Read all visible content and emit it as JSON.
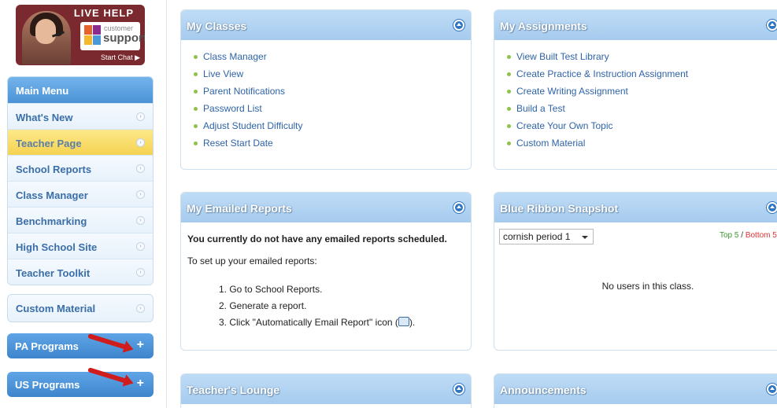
{
  "live_help": {
    "title": "LIVE HELP",
    "logo_small": "customer",
    "logo_big": "support",
    "start_chat": "Start Chat ▶"
  },
  "menu": {
    "header": "Main Menu",
    "items": [
      {
        "label": "What's New"
      },
      {
        "label": "Teacher Page"
      },
      {
        "label": "School Reports"
      },
      {
        "label": "Class Manager"
      },
      {
        "label": "Benchmarking"
      },
      {
        "label": "High School Site"
      },
      {
        "label": "Teacher Toolkit"
      }
    ],
    "active_index": 1
  },
  "custom_material": "Custom Material",
  "programs": {
    "pa": "PA Programs",
    "us": "US Programs",
    "plus": "+"
  },
  "my_classes": {
    "title": "My Classes",
    "links": [
      "Class Manager",
      "Live View",
      "Parent Notifications",
      "Password List",
      "Adjust Student Difficulty",
      "Reset Start Date"
    ]
  },
  "my_assignments": {
    "title": "My Assignments",
    "links": [
      "View Built Test Library",
      "Create Practice & Instruction Assignment",
      "Create Writing Assignment",
      "Build a Test",
      "Create Your Own Topic",
      "Custom Material"
    ]
  },
  "emailed_reports": {
    "title": "My Emailed Reports",
    "notice": "You currently do not have any emailed reports scheduled.",
    "setup": "To set up your emailed reports:",
    "steps": [
      "1. Go to School Reports.",
      "2. Generate a report.",
      "3. Click \"Automatically Email Report\" icon (",
      ")."
    ]
  },
  "blue_ribbon": {
    "title": "Blue Ribbon Snapshot",
    "selected_class": "cornish period 1",
    "top5": "Top 5",
    "sep": " / ",
    "bottom": "Bottom 5",
    "empty": "No users in this class."
  },
  "teachers_lounge": {
    "title": "Teacher's Lounge"
  },
  "announcements": {
    "title": "Announcements"
  },
  "colors": {
    "accent": "#4a93d6",
    "panel_header": "#a6cbee",
    "link": "#2f63a8",
    "active_menu": "#f5d250",
    "arrow": "#d01c1c"
  }
}
